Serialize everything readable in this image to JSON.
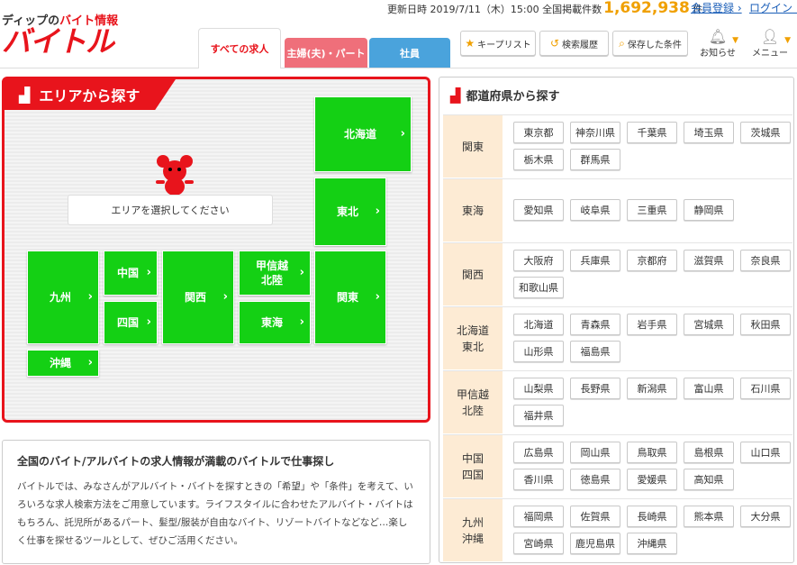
{
  "header": {
    "logo_tagline_prefix": "ディップの",
    "logo_tagline_highlight": "バイト情報",
    "logo_text": "バイトル",
    "update_label": "更新日時",
    "update_datetime": "2019/7/11（木）15:00",
    "count_label": "全国掲載件数",
    "count_value": "1,692,938",
    "count_unit": "件",
    "register_link": "会員登録",
    "login_link": "ログイン",
    "tabs": [
      {
        "label": "すべての求人"
      },
      {
        "label": "主婦(夫)・パート"
      },
      {
        "label": "社員"
      }
    ],
    "buttons": {
      "keep_list": "キープリスト",
      "history": "検索履歴",
      "saved": "保存した条件"
    },
    "notifications_label": "お知らせ",
    "menu_label": "メニュー"
  },
  "area": {
    "title": "エリアから探す",
    "bubble": "エリアを選択してください",
    "regions": {
      "hokkaido": "北海道",
      "tohoku": "東北",
      "kyushu": "九州",
      "chugoku": "中国",
      "shikoku": "四国",
      "kansai": "関西",
      "koshinetsu_l1": "甲信越",
      "koshinetsu_l2": "北陸",
      "tokai": "東海",
      "kanto": "関東",
      "okinawa": "沖縄"
    }
  },
  "description": {
    "heading": "全国のバイト/アルバイトの求人情報が満載のバイトルで仕事探し",
    "body": "バイトルでは、みなさんがアルバイト・バイトを探すときの「希望」や「条件」を考えて、いろいろな求人検索方法をご用意しています。ライフスタイルに合わせたアルバイト・バイトはもちろん、託児所があるパート、髪型/服装が自由なバイト、リゾートバイトなどなど…楽しく仕事を探せるツールとして、ぜひご活用ください。"
  },
  "prefectures": {
    "title": "都道府県から探す",
    "rows": [
      {
        "l1": "関東",
        "l2": "",
        "items": [
          "東京都",
          "神奈川県",
          "千葉県",
          "埼玉県",
          "茨城県",
          "栃木県",
          "群馬県"
        ]
      },
      {
        "l1": "東海",
        "l2": "",
        "items": [
          "愛知県",
          "岐阜県",
          "三重県",
          "静岡県"
        ]
      },
      {
        "l1": "関西",
        "l2": "",
        "items": [
          "大阪府",
          "兵庫県",
          "京都府",
          "滋賀県",
          "奈良県",
          "和歌山県"
        ]
      },
      {
        "l1": "北海道",
        "l2": "東北",
        "items": [
          "北海道",
          "青森県",
          "岩手県",
          "宮城県",
          "秋田県",
          "山形県",
          "福島県"
        ]
      },
      {
        "l1": "甲信越",
        "l2": "北陸",
        "items": [
          "山梨県",
          "長野県",
          "新潟県",
          "富山県",
          "石川県",
          "福井県"
        ]
      },
      {
        "l1": "中国",
        "l2": "四国",
        "items": [
          "広島県",
          "岡山県",
          "鳥取県",
          "島根県",
          "山口県",
          "香川県",
          "徳島県",
          "愛媛県",
          "高知県"
        ]
      },
      {
        "l1": "九州",
        "l2": "沖縄",
        "items": [
          "福岡県",
          "佐賀県",
          "長崎県",
          "熊本県",
          "大分県",
          "宮崎県",
          "鹿児島県",
          "沖縄県"
        ]
      }
    ]
  },
  "colors": {
    "brand_red": "#e8141c",
    "region_green": "#14d014",
    "count_orange": "#f0a000",
    "link_blue": "#1a5eb8"
  }
}
